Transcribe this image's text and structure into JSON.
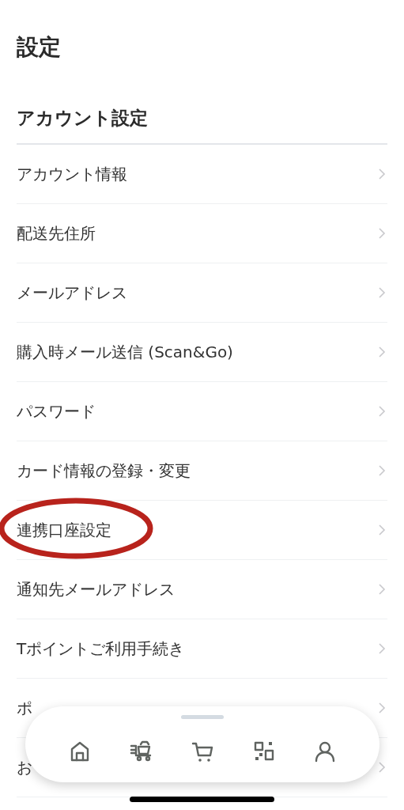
{
  "title": "設定",
  "section": {
    "heading": "アカウント設定"
  },
  "items": [
    {
      "label": "アカウント情報",
      "circled": false
    },
    {
      "label": "配送先住所",
      "circled": false
    },
    {
      "label": "メールアドレス",
      "circled": false
    },
    {
      "label": "購入時メール送信 (Scan&Go)",
      "circled": false
    },
    {
      "label": "パスワード",
      "circled": false
    },
    {
      "label": "カード情報の登録・変更",
      "circled": false
    },
    {
      "label": "連携口座設定",
      "circled": true
    },
    {
      "label": "通知先メールアドレス",
      "circled": false
    },
    {
      "label": "Tポイントご利用手続き",
      "circled": false
    },
    {
      "label": "ポ",
      "circled": false
    },
    {
      "label": "お",
      "circled": false
    }
  ],
  "bottom_nav": [
    {
      "kind": "home"
    },
    {
      "kind": "basket-cart"
    },
    {
      "kind": "cart"
    },
    {
      "kind": "qr"
    },
    {
      "kind": "person"
    }
  ]
}
